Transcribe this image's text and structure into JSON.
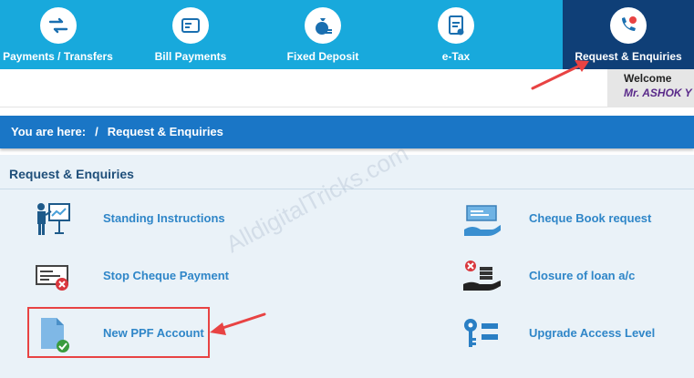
{
  "nav": {
    "items": [
      {
        "label": "Payments / Transfers",
        "icon": "transfer-arrows-icon"
      },
      {
        "label": "Bill Payments",
        "icon": "bill-card-icon"
      },
      {
        "label": "Fixed Deposit",
        "icon": "money-bag-icon"
      },
      {
        "label": "e-Tax",
        "icon": "tax-document-icon"
      },
      {
        "label": "Request & Enquiries",
        "icon": "phone-chat-icon"
      }
    ],
    "active_index": 4
  },
  "welcome": {
    "greeting": "Welcome",
    "user": "Mr. ASHOK Y"
  },
  "breadcrumb": {
    "prefix": "You are here:",
    "separator": "/",
    "current": "Request & Enquiries"
  },
  "panel": {
    "title": "Request & Enquiries",
    "left_services": [
      {
        "label": "Standing Instructions",
        "icon": "presentation-board-icon"
      },
      {
        "label": "Stop Cheque Payment",
        "icon": "cheque-cancel-icon"
      },
      {
        "label": "New PPF Account",
        "icon": "document-check-icon"
      }
    ],
    "right_services": [
      {
        "label": "Cheque Book request",
        "icon": "cheque-hand-icon"
      },
      {
        "label": "Closure of loan a/c",
        "icon": "loan-close-icon"
      },
      {
        "label": "Upgrade Access Level",
        "icon": "key-access-icon"
      }
    ]
  },
  "watermark": "AlldigitalTricks.com",
  "colors": {
    "nav_bg": "#18a9dc",
    "nav_active": "#0f3f77",
    "breadcrumb_bg": "#1a76c6",
    "link": "#2f86c8",
    "annotation": "#e84343"
  }
}
